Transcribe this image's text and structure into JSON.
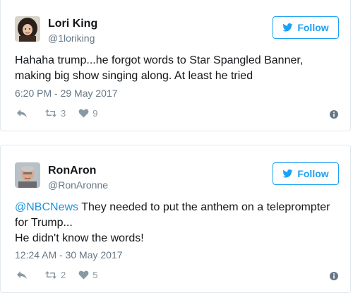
{
  "tweets": [
    {
      "name": "Lori King",
      "handle": "@1loriking",
      "follow_label": "Follow",
      "text_lines": [
        "Hahaha trump...he forgot words to Star Spangled Banner,",
        "making big show singing along. At least he tried"
      ],
      "timestamp": "6:20 PM - 29 May 2017",
      "retweets": "3",
      "likes": "9"
    },
    {
      "name": "RonAron",
      "handle": "@RonAronne",
      "follow_label": "Follow",
      "mention": "@NBCNews",
      "text_first": " They needed to put the anthem on a teleprompter",
      "text_lines": [
        "for Trump...",
        "He didn't know the words!"
      ],
      "timestamp": "12:24 AM - 30 May 2017",
      "retweets": "2",
      "likes": "5"
    }
  ],
  "colors": {
    "twitter_blue": "#1da1f2",
    "link_blue": "#1b95e0",
    "text": "#14171a",
    "muted": "#657786",
    "action_gray": "#8899a6"
  },
  "icons": {
    "follow": "twitter-bird-icon",
    "reply": "reply-icon",
    "retweet": "retweet-icon",
    "like": "heart-icon",
    "more": "info-icon"
  }
}
